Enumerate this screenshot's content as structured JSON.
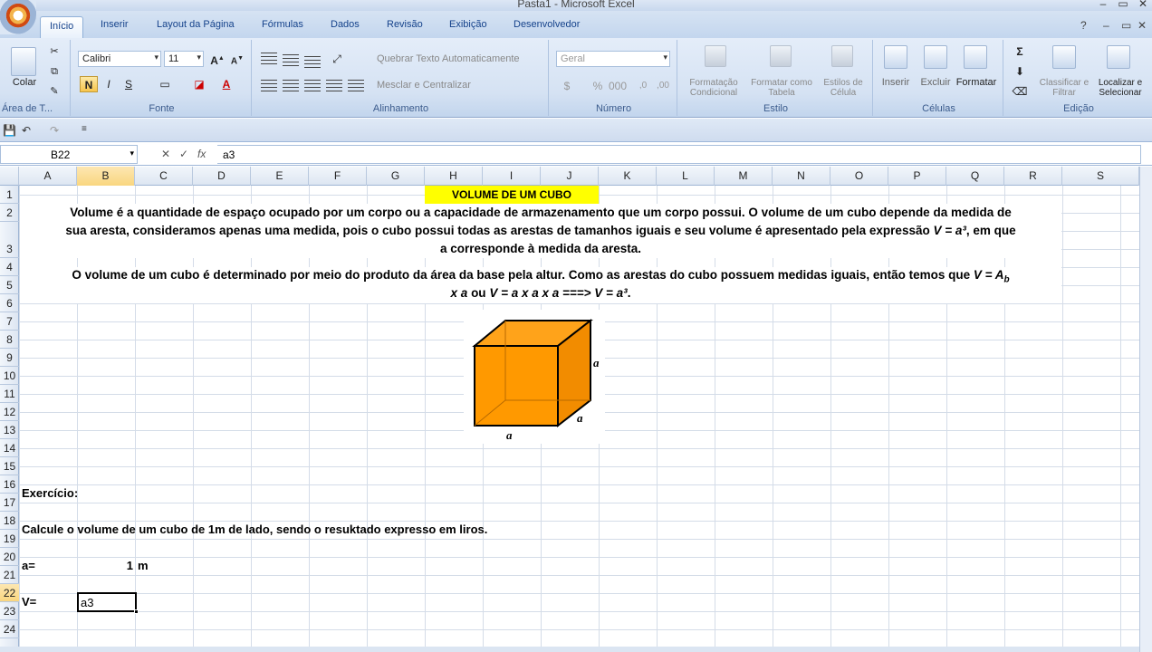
{
  "window": {
    "title": "Pasta1 - Microsoft Excel"
  },
  "tabs": [
    "Início",
    "Inserir",
    "Layout da Página",
    "Fórmulas",
    "Dados",
    "Revisão",
    "Exibição",
    "Desenvolvedor"
  ],
  "ribbon": {
    "clipboard": {
      "paste_label": "Colar",
      "group_label": "Área de T..."
    },
    "font": {
      "font_name": "Calibri",
      "font_size": "11",
      "bold": "N",
      "italic": "I",
      "underline": "S",
      "group_label": "Fonte"
    },
    "alignment": {
      "wrap_text": "Quebrar Texto Automaticamente",
      "merge_center": "Mesclar e Centralizar",
      "group_label": "Alinhamento"
    },
    "number": {
      "format": "Geral",
      "group_label": "Número"
    },
    "styles": {
      "conditional": "Formatação Condicional",
      "as_table": "Formatar como Tabela",
      "cell_styles": "Estilos de Célula",
      "group_label": "Estilo"
    },
    "cells": {
      "insert": "Inserir",
      "delete": "Excluir",
      "format": "Formatar",
      "group_label": "Células"
    },
    "editing": {
      "sort": "Classificar e Filtrar",
      "find": "Localizar e Selecionar",
      "group_label": "Edição"
    }
  },
  "formula_bar": {
    "name_box": "B22",
    "content": "a3"
  },
  "columns": [
    "A",
    "B",
    "C",
    "D",
    "E",
    "F",
    "G",
    "H",
    "I",
    "J",
    "K",
    "L",
    "M",
    "N",
    "O",
    "P",
    "Q",
    "R",
    "S"
  ],
  "rows": [
    "1",
    "2",
    "3",
    "4",
    "5",
    "6",
    "7",
    "8",
    "9",
    "10",
    "11",
    "12",
    "13",
    "14",
    "15",
    "16",
    "17",
    "18",
    "19",
    "20",
    "21",
    "22",
    "23",
    "24"
  ],
  "sheet": {
    "title": "VOLUME DE UM CUBO",
    "p1_line1": "Volume é a quantidade de espaço ocupado por um corpo ou a capacidade de armazenamento que um corpo possui. O volume de um cubo depende da medida de",
    "p1_line2a": "sua aresta, consideramos apenas uma medida, pois o cubo possui todas as arestas de tamanhos iguais e seu volume é apresentado pela expressão ",
    "p1_line2b": "V = a³",
    "p1_line2c": ", em que",
    "p1_line3": "a corresponde à medida da aresta.",
    "p2_line1a": "O volume de um cubo é determinado por meio do produto da área da base pela altur. Como as arestas do cubo possuem medidas iguais, então temos que ",
    "p2_line1b": "V = A",
    "p2_line1c": "b",
    "p2_line2a": "x a",
    "p2_line2b": " ou ",
    "p2_line2c": "V = a x a x a ===> V = a³",
    "p2_line2d": ".",
    "cube_label_right": "a",
    "cube_label_front": "a",
    "cube_label_bottom": "a",
    "exercise": "Exercício:",
    "question": "Calcule o volume de um cubo de 1m de lado, sendo o resuktado expresso em liros.",
    "a_label": "a=",
    "a_value": "1",
    "a_unit": "m",
    "v_label": "V=",
    "v_value": "a3"
  },
  "colors": {
    "cube": "#ff9900",
    "title_bg": "#ffff00",
    "selected_header": "#f9d67f"
  }
}
